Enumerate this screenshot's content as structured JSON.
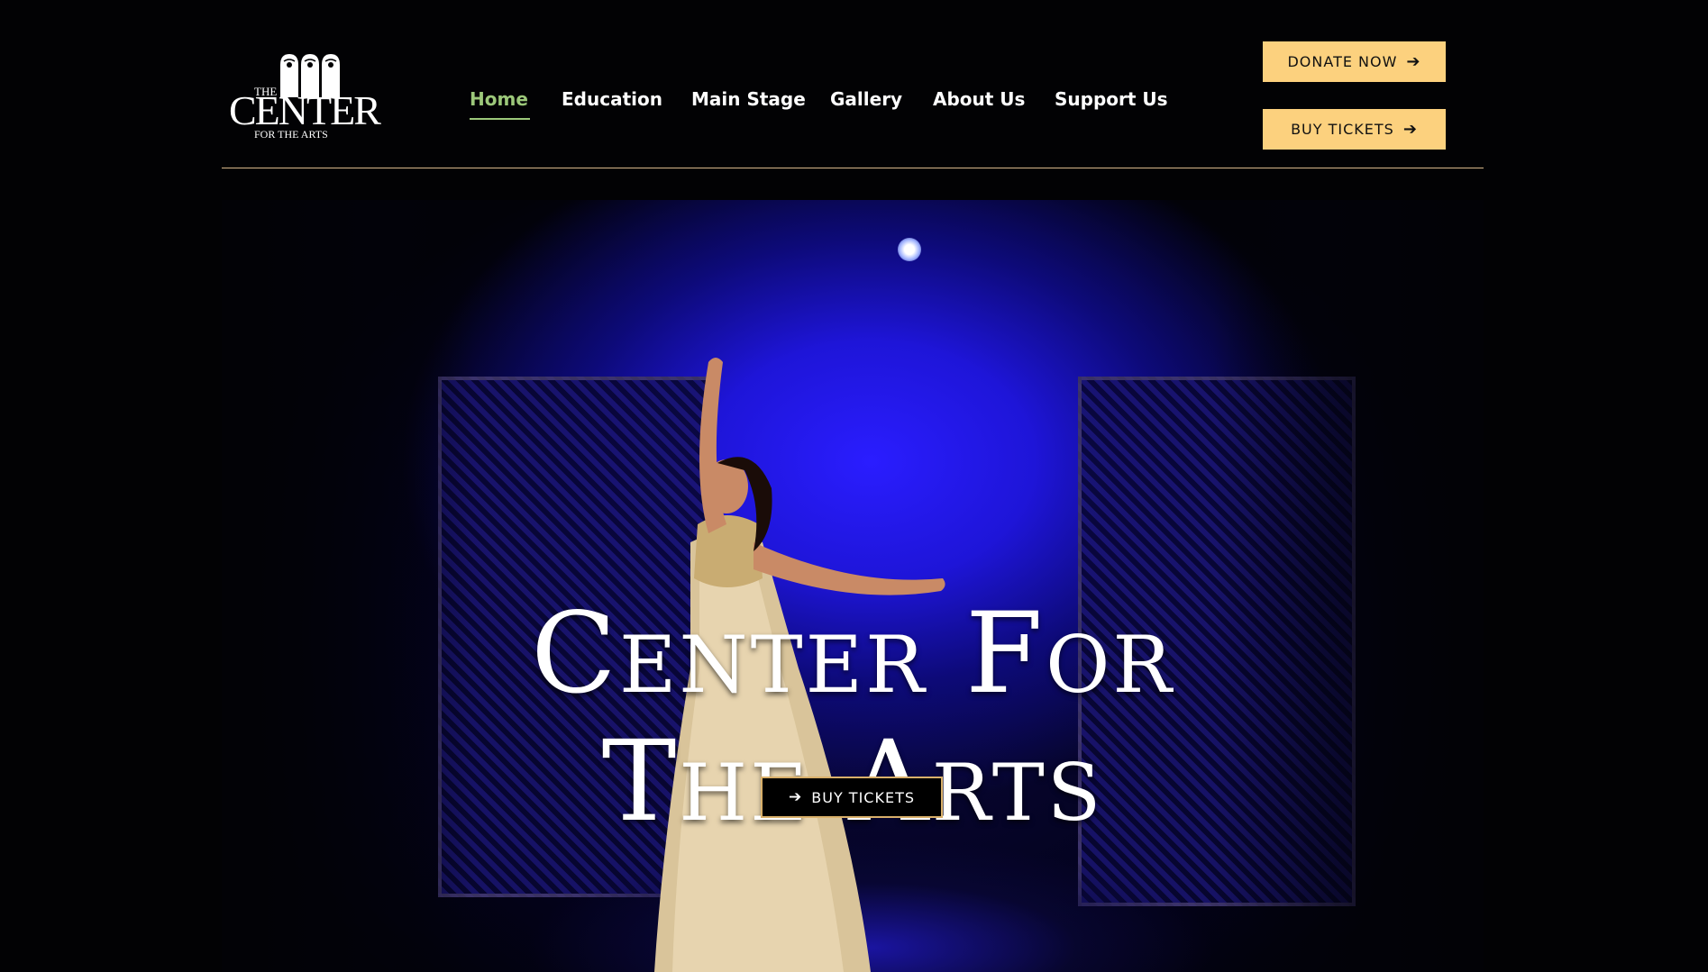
{
  "logo": {
    "line1": "THE",
    "line2": "CENTER",
    "line3": "FOR THE ARTS"
  },
  "nav": {
    "items": [
      {
        "label": "Home",
        "active": true
      },
      {
        "label": "Education"
      },
      {
        "label": "Main Stage"
      },
      {
        "label": "Gallery"
      },
      {
        "label": "About Us"
      },
      {
        "label": "Support Us"
      }
    ]
  },
  "header_ctas": {
    "donate": "DONATE NOW",
    "buy": "BUY TICKETS"
  },
  "hero": {
    "title_line1": "Center For",
    "title_line2": "The Arts",
    "button": "BUY TICKETS"
  },
  "colors": {
    "background": "#020204",
    "accent_gold": "#fcd17e",
    "nav_active": "#9cc87a",
    "stage_blue": "#2a1dff"
  },
  "icons": {
    "cta_arrow": "arrow-right-icon"
  }
}
